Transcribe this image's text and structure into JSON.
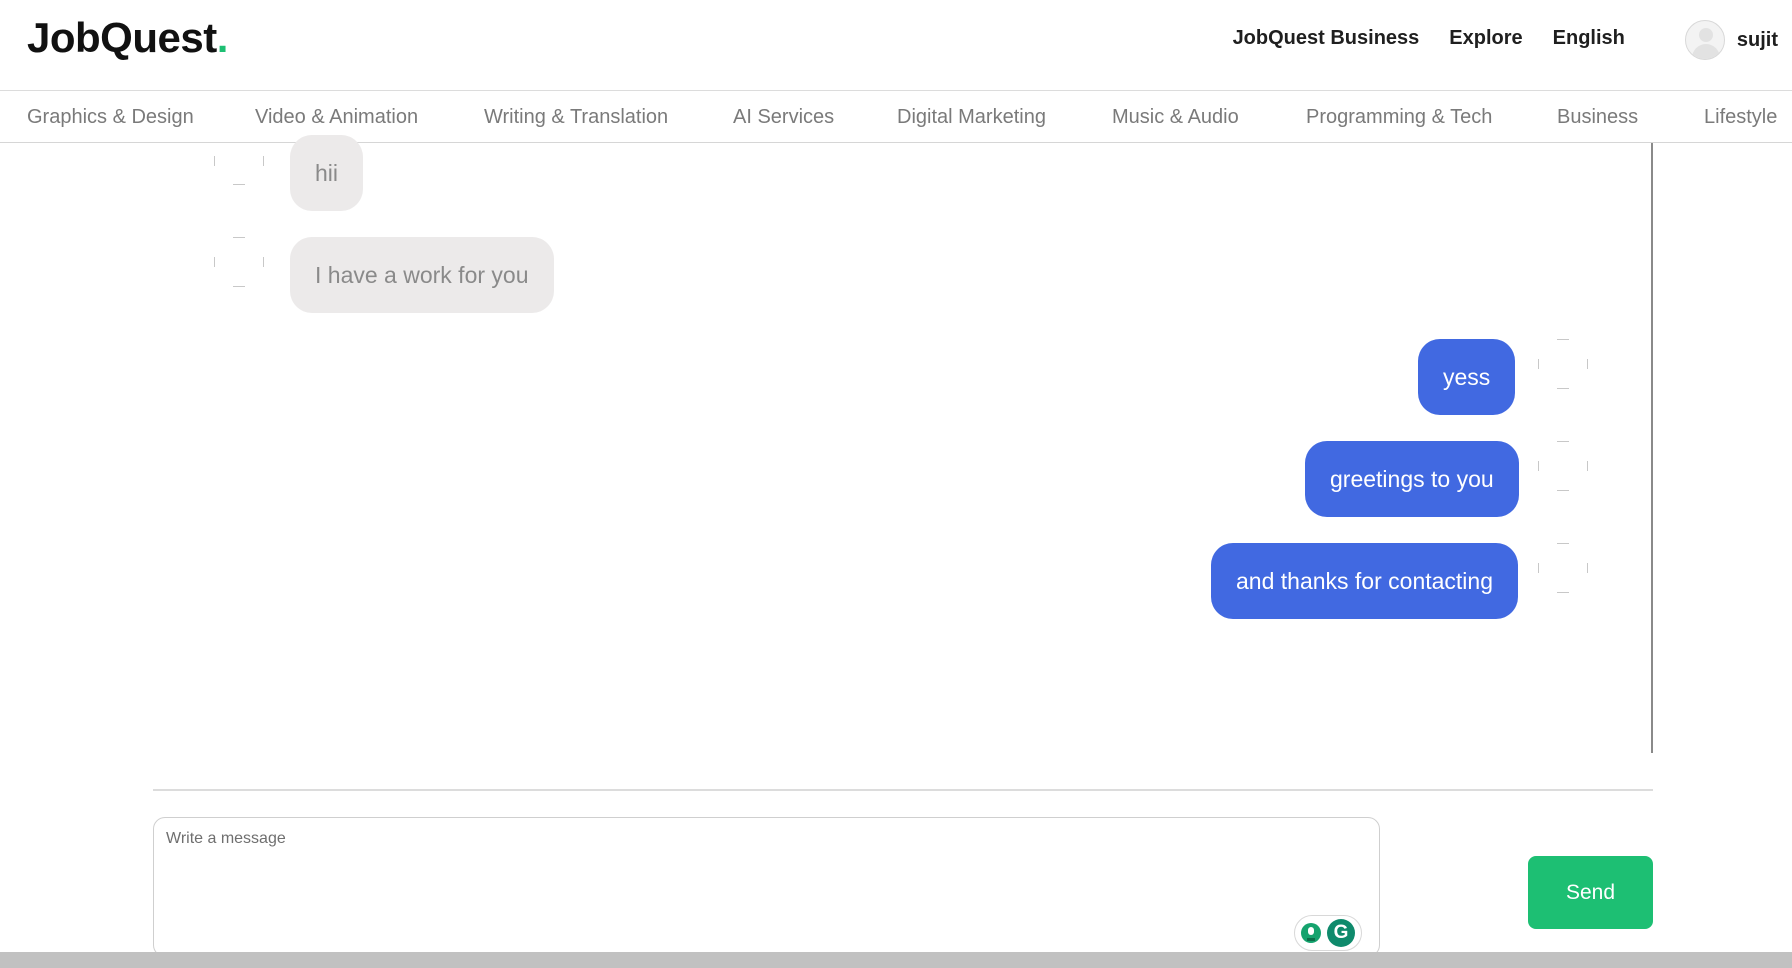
{
  "header": {
    "logo_text": "JobQuest",
    "logo_dot": ".",
    "nav": [
      "JobQuest Business",
      "Explore",
      "English"
    ],
    "username": "sujit"
  },
  "categories": [
    "Graphics & Design",
    "Video & Animation",
    "Writing & Translation",
    "AI Services",
    "Digital Marketing",
    "Music & Audio",
    "Programming & Tech",
    "Business",
    "Lifestyle"
  ],
  "messages": [
    {
      "direction": "incoming",
      "text": "hii"
    },
    {
      "direction": "incoming",
      "text": "I have a work for you"
    },
    {
      "direction": "outgoing",
      "text": "yess"
    },
    {
      "direction": "outgoing",
      "text": "greetings to you"
    },
    {
      "direction": "outgoing",
      "text": "and thanks for contacting"
    }
  ],
  "composer": {
    "placeholder": "Write a message",
    "value": ""
  },
  "send_label": "Send",
  "colors": {
    "brand_green": "#1dbf73",
    "outgoing_bubble": "#4169e1",
    "incoming_bubble": "#eceaea"
  }
}
